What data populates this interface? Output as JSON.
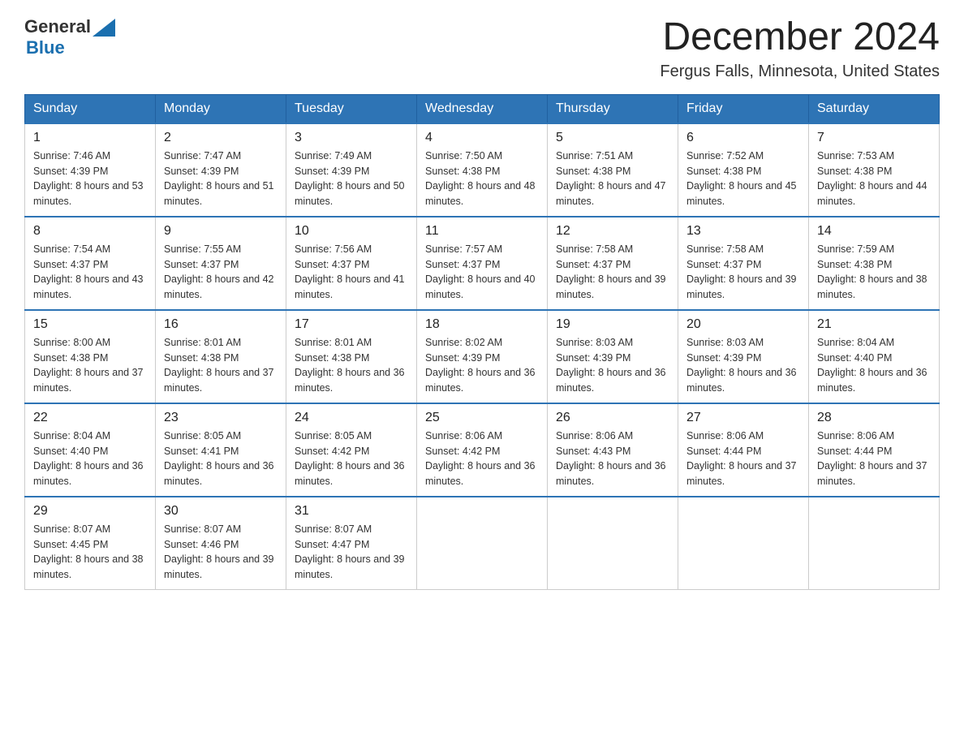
{
  "header": {
    "logo": {
      "general": "General",
      "blue": "Blue",
      "aria": "GeneralBlue logo"
    },
    "title": "December 2024",
    "location": "Fergus Falls, Minnesota, United States"
  },
  "calendar": {
    "days_of_week": [
      "Sunday",
      "Monday",
      "Tuesday",
      "Wednesday",
      "Thursday",
      "Friday",
      "Saturday"
    ],
    "weeks": [
      [
        {
          "date": "1",
          "sunrise": "Sunrise: 7:46 AM",
          "sunset": "Sunset: 4:39 PM",
          "daylight": "Daylight: 8 hours and 53 minutes."
        },
        {
          "date": "2",
          "sunrise": "Sunrise: 7:47 AM",
          "sunset": "Sunset: 4:39 PM",
          "daylight": "Daylight: 8 hours and 51 minutes."
        },
        {
          "date": "3",
          "sunrise": "Sunrise: 7:49 AM",
          "sunset": "Sunset: 4:39 PM",
          "daylight": "Daylight: 8 hours and 50 minutes."
        },
        {
          "date": "4",
          "sunrise": "Sunrise: 7:50 AM",
          "sunset": "Sunset: 4:38 PM",
          "daylight": "Daylight: 8 hours and 48 minutes."
        },
        {
          "date": "5",
          "sunrise": "Sunrise: 7:51 AM",
          "sunset": "Sunset: 4:38 PM",
          "daylight": "Daylight: 8 hours and 47 minutes."
        },
        {
          "date": "6",
          "sunrise": "Sunrise: 7:52 AM",
          "sunset": "Sunset: 4:38 PM",
          "daylight": "Daylight: 8 hours and 45 minutes."
        },
        {
          "date": "7",
          "sunrise": "Sunrise: 7:53 AM",
          "sunset": "Sunset: 4:38 PM",
          "daylight": "Daylight: 8 hours and 44 minutes."
        }
      ],
      [
        {
          "date": "8",
          "sunrise": "Sunrise: 7:54 AM",
          "sunset": "Sunset: 4:37 PM",
          "daylight": "Daylight: 8 hours and 43 minutes."
        },
        {
          "date": "9",
          "sunrise": "Sunrise: 7:55 AM",
          "sunset": "Sunset: 4:37 PM",
          "daylight": "Daylight: 8 hours and 42 minutes."
        },
        {
          "date": "10",
          "sunrise": "Sunrise: 7:56 AM",
          "sunset": "Sunset: 4:37 PM",
          "daylight": "Daylight: 8 hours and 41 minutes."
        },
        {
          "date": "11",
          "sunrise": "Sunrise: 7:57 AM",
          "sunset": "Sunset: 4:37 PM",
          "daylight": "Daylight: 8 hours and 40 minutes."
        },
        {
          "date": "12",
          "sunrise": "Sunrise: 7:58 AM",
          "sunset": "Sunset: 4:37 PM",
          "daylight": "Daylight: 8 hours and 39 minutes."
        },
        {
          "date": "13",
          "sunrise": "Sunrise: 7:58 AM",
          "sunset": "Sunset: 4:37 PM",
          "daylight": "Daylight: 8 hours and 39 minutes."
        },
        {
          "date": "14",
          "sunrise": "Sunrise: 7:59 AM",
          "sunset": "Sunset: 4:38 PM",
          "daylight": "Daylight: 8 hours and 38 minutes."
        }
      ],
      [
        {
          "date": "15",
          "sunrise": "Sunrise: 8:00 AM",
          "sunset": "Sunset: 4:38 PM",
          "daylight": "Daylight: 8 hours and 37 minutes."
        },
        {
          "date": "16",
          "sunrise": "Sunrise: 8:01 AM",
          "sunset": "Sunset: 4:38 PM",
          "daylight": "Daylight: 8 hours and 37 minutes."
        },
        {
          "date": "17",
          "sunrise": "Sunrise: 8:01 AM",
          "sunset": "Sunset: 4:38 PM",
          "daylight": "Daylight: 8 hours and 36 minutes."
        },
        {
          "date": "18",
          "sunrise": "Sunrise: 8:02 AM",
          "sunset": "Sunset: 4:39 PM",
          "daylight": "Daylight: 8 hours and 36 minutes."
        },
        {
          "date": "19",
          "sunrise": "Sunrise: 8:03 AM",
          "sunset": "Sunset: 4:39 PM",
          "daylight": "Daylight: 8 hours and 36 minutes."
        },
        {
          "date": "20",
          "sunrise": "Sunrise: 8:03 AM",
          "sunset": "Sunset: 4:39 PM",
          "daylight": "Daylight: 8 hours and 36 minutes."
        },
        {
          "date": "21",
          "sunrise": "Sunrise: 8:04 AM",
          "sunset": "Sunset: 4:40 PM",
          "daylight": "Daylight: 8 hours and 36 minutes."
        }
      ],
      [
        {
          "date": "22",
          "sunrise": "Sunrise: 8:04 AM",
          "sunset": "Sunset: 4:40 PM",
          "daylight": "Daylight: 8 hours and 36 minutes."
        },
        {
          "date": "23",
          "sunrise": "Sunrise: 8:05 AM",
          "sunset": "Sunset: 4:41 PM",
          "daylight": "Daylight: 8 hours and 36 minutes."
        },
        {
          "date": "24",
          "sunrise": "Sunrise: 8:05 AM",
          "sunset": "Sunset: 4:42 PM",
          "daylight": "Daylight: 8 hours and 36 minutes."
        },
        {
          "date": "25",
          "sunrise": "Sunrise: 8:06 AM",
          "sunset": "Sunset: 4:42 PM",
          "daylight": "Daylight: 8 hours and 36 minutes."
        },
        {
          "date": "26",
          "sunrise": "Sunrise: 8:06 AM",
          "sunset": "Sunset: 4:43 PM",
          "daylight": "Daylight: 8 hours and 36 minutes."
        },
        {
          "date": "27",
          "sunrise": "Sunrise: 8:06 AM",
          "sunset": "Sunset: 4:44 PM",
          "daylight": "Daylight: 8 hours and 37 minutes."
        },
        {
          "date": "28",
          "sunrise": "Sunrise: 8:06 AM",
          "sunset": "Sunset: 4:44 PM",
          "daylight": "Daylight: 8 hours and 37 minutes."
        }
      ],
      [
        {
          "date": "29",
          "sunrise": "Sunrise: 8:07 AM",
          "sunset": "Sunset: 4:45 PM",
          "daylight": "Daylight: 8 hours and 38 minutes."
        },
        {
          "date": "30",
          "sunrise": "Sunrise: 8:07 AM",
          "sunset": "Sunset: 4:46 PM",
          "daylight": "Daylight: 8 hours and 39 minutes."
        },
        {
          "date": "31",
          "sunrise": "Sunrise: 8:07 AM",
          "sunset": "Sunset: 4:47 PM",
          "daylight": "Daylight: 8 hours and 39 minutes."
        },
        null,
        null,
        null,
        null
      ]
    ]
  }
}
